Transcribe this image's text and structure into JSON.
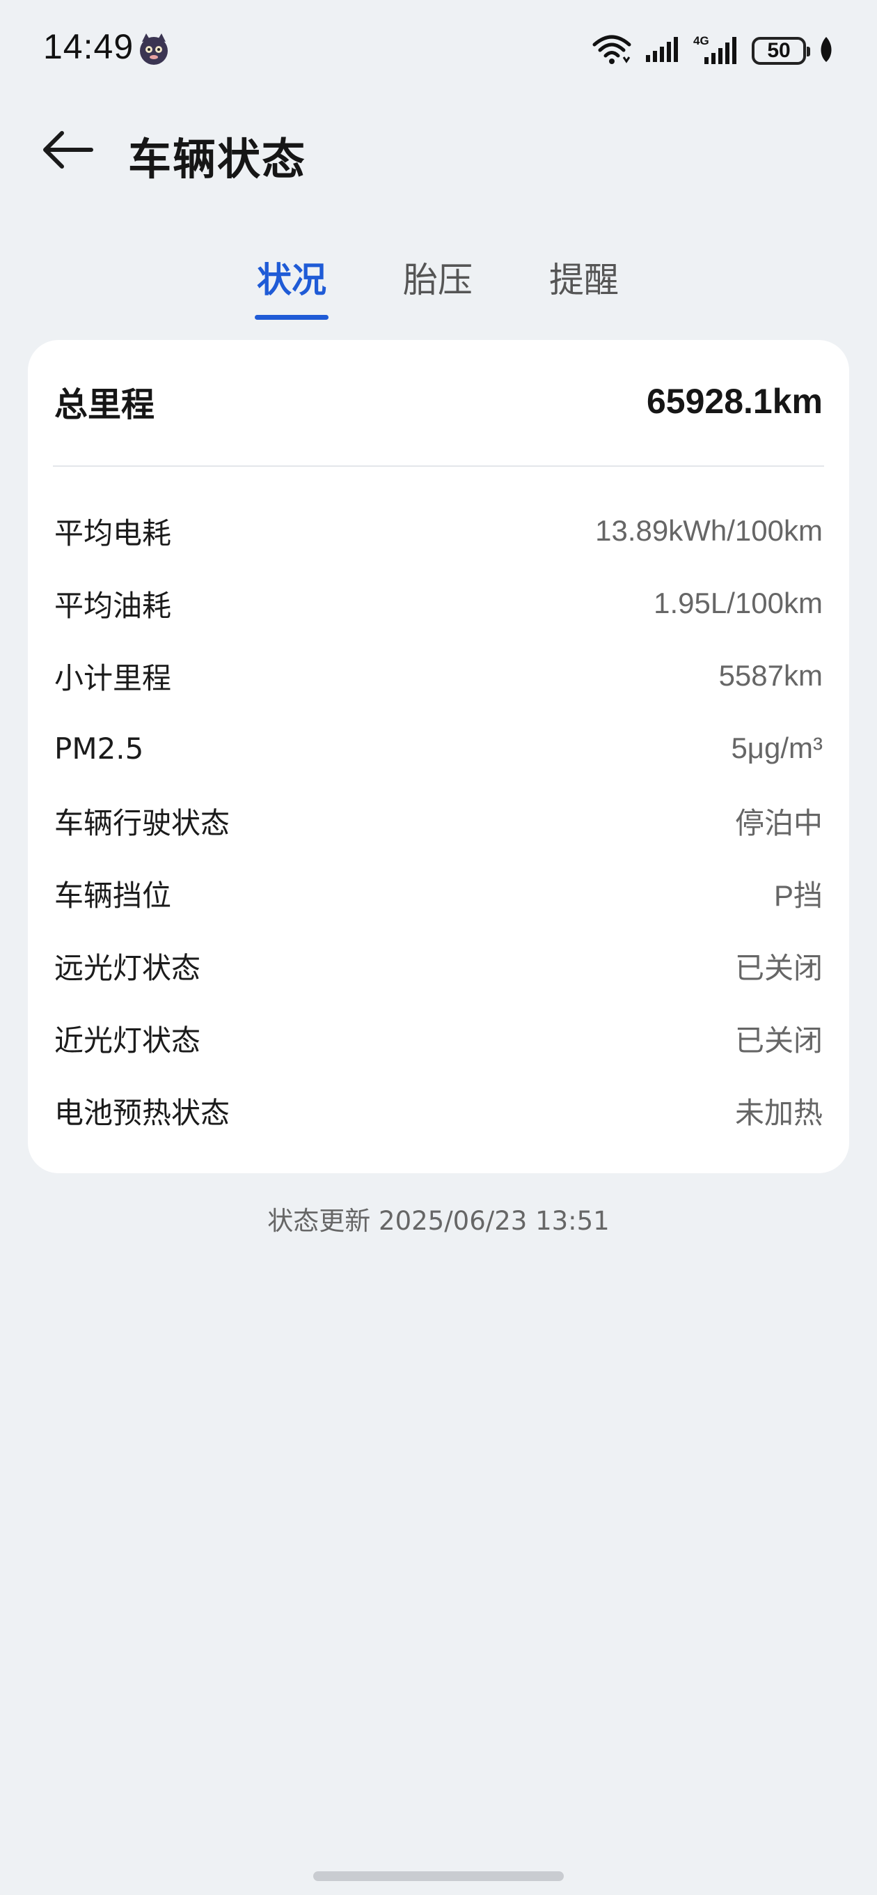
{
  "status_bar": {
    "time": "14:49",
    "battery_level": "50",
    "network_label": "4G"
  },
  "header": {
    "title": "车辆状态"
  },
  "tabs": [
    {
      "label": "状况",
      "active": true
    },
    {
      "label": "胎压",
      "active": false
    },
    {
      "label": "提醒",
      "active": false
    }
  ],
  "card": {
    "total_mileage": {
      "label": "总里程",
      "value": "65928.1km"
    },
    "rows": [
      {
        "label": "平均电耗",
        "value": "13.89kWh/100km"
      },
      {
        "label": "平均油耗",
        "value": "1.95L/100km"
      },
      {
        "label": "小计里程",
        "value": "5587km"
      },
      {
        "label": "PM2.5",
        "value": "5μg/m³"
      },
      {
        "label": "车辆行驶状态",
        "value": "停泊中"
      },
      {
        "label": "车辆挡位",
        "value": "P挡"
      },
      {
        "label": "远光灯状态",
        "value": "已关闭"
      },
      {
        "label": "近光灯状态",
        "value": "已关闭"
      },
      {
        "label": "电池预热状态",
        "value": "未加热"
      }
    ]
  },
  "footer": {
    "update_time": "状态更新 2025/06/23 13:51"
  },
  "colors": {
    "accent": "#1f5bd6",
    "background": "#eef1f4",
    "card": "#ffffff"
  }
}
